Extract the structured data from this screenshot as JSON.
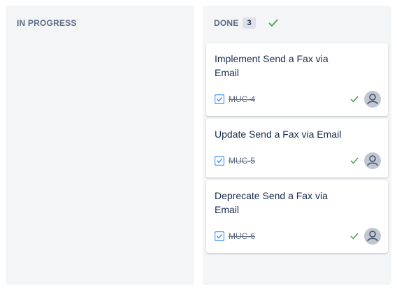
{
  "columns": [
    {
      "title": "IN PROGRESS"
    },
    {
      "title": "DONE",
      "count": "3",
      "cards": [
        {
          "title": "Implement Send a Fax via Email",
          "key": "MUC-4"
        },
        {
          "title": "Update Send a Fax via Email",
          "key": "MUC-5"
        },
        {
          "title": "Deprecate Send a Fax via Email",
          "key": "MUC-6"
        }
      ]
    }
  ],
  "icons": {
    "type": "checkbox-task-icon",
    "done": "check-icon",
    "avatar": "user-avatar-icon"
  },
  "colors": {
    "column_bg": "#f4f5f7",
    "task_blue": "#4c9aff",
    "done_green": "#36b37e"
  }
}
